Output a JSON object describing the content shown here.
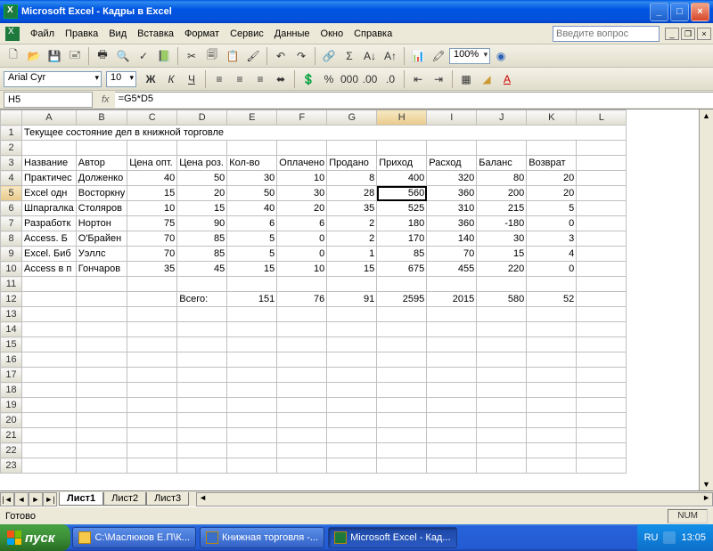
{
  "window": {
    "title": "Microsoft Excel - Кадры в Excel"
  },
  "menu": {
    "file": "Файл",
    "edit": "Правка",
    "view": "Вид",
    "insert": "Вставка",
    "format": "Формат",
    "tools": "Сервис",
    "data": "Данные",
    "window": "Окно",
    "help": "Справка",
    "question_placeholder": "Введите вопрос"
  },
  "toolbar": {
    "zoom": "100%"
  },
  "format": {
    "font": "Arial Cyr",
    "size": "10"
  },
  "formula": {
    "cellref": "H5",
    "fx": "fx",
    "value": "=G5*D5"
  },
  "columns": [
    "A",
    "B",
    "C",
    "D",
    "E",
    "F",
    "G",
    "H",
    "I",
    "J",
    "K",
    "L"
  ],
  "title_row": "Текущее состояние дел в книжной торговле",
  "headers": [
    "Название",
    "Автор",
    "Цена опт.",
    "Цена роз.",
    "Кол-во",
    "Оплачено",
    "Продано",
    "Приход",
    "Расход",
    "Баланс",
    "Возврат"
  ],
  "rows": [
    {
      "r": 4,
      "c": [
        "Практичес",
        "Долженко",
        "40",
        "50",
        "30",
        "10",
        "8",
        "400",
        "320",
        "80",
        "20"
      ]
    },
    {
      "r": 5,
      "c": [
        "Excel одн",
        "Восторкну",
        "15",
        "20",
        "50",
        "30",
        "28",
        "560",
        "360",
        "200",
        "20"
      ],
      "sel": 8
    },
    {
      "r": 6,
      "c": [
        "Шпаргалка",
        "Столяров",
        "10",
        "15",
        "40",
        "20",
        "35",
        "525",
        "310",
        "215",
        "5"
      ]
    },
    {
      "r": 7,
      "c": [
        "Разработк",
        "Нортон",
        "75",
        "90",
        "6",
        "6",
        "2",
        "180",
        "360",
        "-180",
        "0"
      ]
    },
    {
      "r": 8,
      "c": [
        "Access. Б",
        "О'Брайен",
        "70",
        "85",
        "5",
        "0",
        "2",
        "170",
        "140",
        "30",
        "3"
      ]
    },
    {
      "r": 9,
      "c": [
        "Excel. Биб",
        "Уэллс",
        "70",
        "85",
        "5",
        "0",
        "1",
        "85",
        "70",
        "15",
        "4"
      ]
    },
    {
      "r": 10,
      "c": [
        "Access в п",
        "Гончаров",
        "35",
        "45",
        "15",
        "10",
        "15",
        "675",
        "455",
        "220",
        "0"
      ]
    }
  ],
  "totals": {
    "r": 12,
    "label": "Всего:",
    "v": [
      "",
      "",
      "",
      "",
      "151",
      "76",
      "91",
      "2595",
      "2015",
      "580",
      "52"
    ]
  },
  "empty_rows": [
    2,
    11,
    13,
    14,
    15,
    16,
    17,
    18,
    19,
    20,
    21,
    22,
    23
  ],
  "tabs": {
    "active": "Лист1",
    "t2": "Лист2",
    "t3": "Лист3"
  },
  "status": {
    "ready": "Готово",
    "num": "NUM"
  },
  "taskbar": {
    "start": "пуск",
    "btn1": "С:\\Маслюков Е.П\\К...",
    "btn2": "Книжная торговля -...",
    "btn3": "Microsoft Excel - Кад...",
    "lang": "RU",
    "time": "13:05"
  },
  "selected_cell": "H5"
}
